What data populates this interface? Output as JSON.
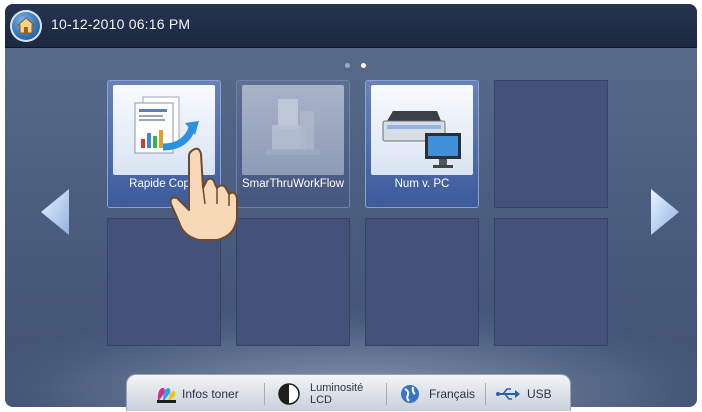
{
  "topbar": {
    "datetime": "10-12-2010 06:16 PM"
  },
  "icons": {
    "home": "home-icon",
    "left": "arrow-left-icon",
    "right": "arrow-right-icon"
  },
  "pager": {
    "total": 2,
    "active": 2
  },
  "apps": [
    {
      "label": "Rapide Copie",
      "icon": "rapid-copy-icon",
      "enabled": true
    },
    {
      "label": "SmarThruWorkFlow",
      "icon": "workflow-icon",
      "enabled": false
    },
    {
      "label": "Num v. PC",
      "icon": "scanner-to-pc-icon",
      "enabled": true
    }
  ],
  "statusbar": {
    "toner_label": "Infos toner",
    "lcd_line1": "Luminosité",
    "lcd_line2": "LCD",
    "language_label": "Français",
    "usb_label": "USB"
  },
  "colors": {
    "screen_bg": "#4d5f80",
    "topbar_bg": "#1b2840",
    "tile_empty": "#42527a",
    "tile_app": "#3c5b9c"
  }
}
